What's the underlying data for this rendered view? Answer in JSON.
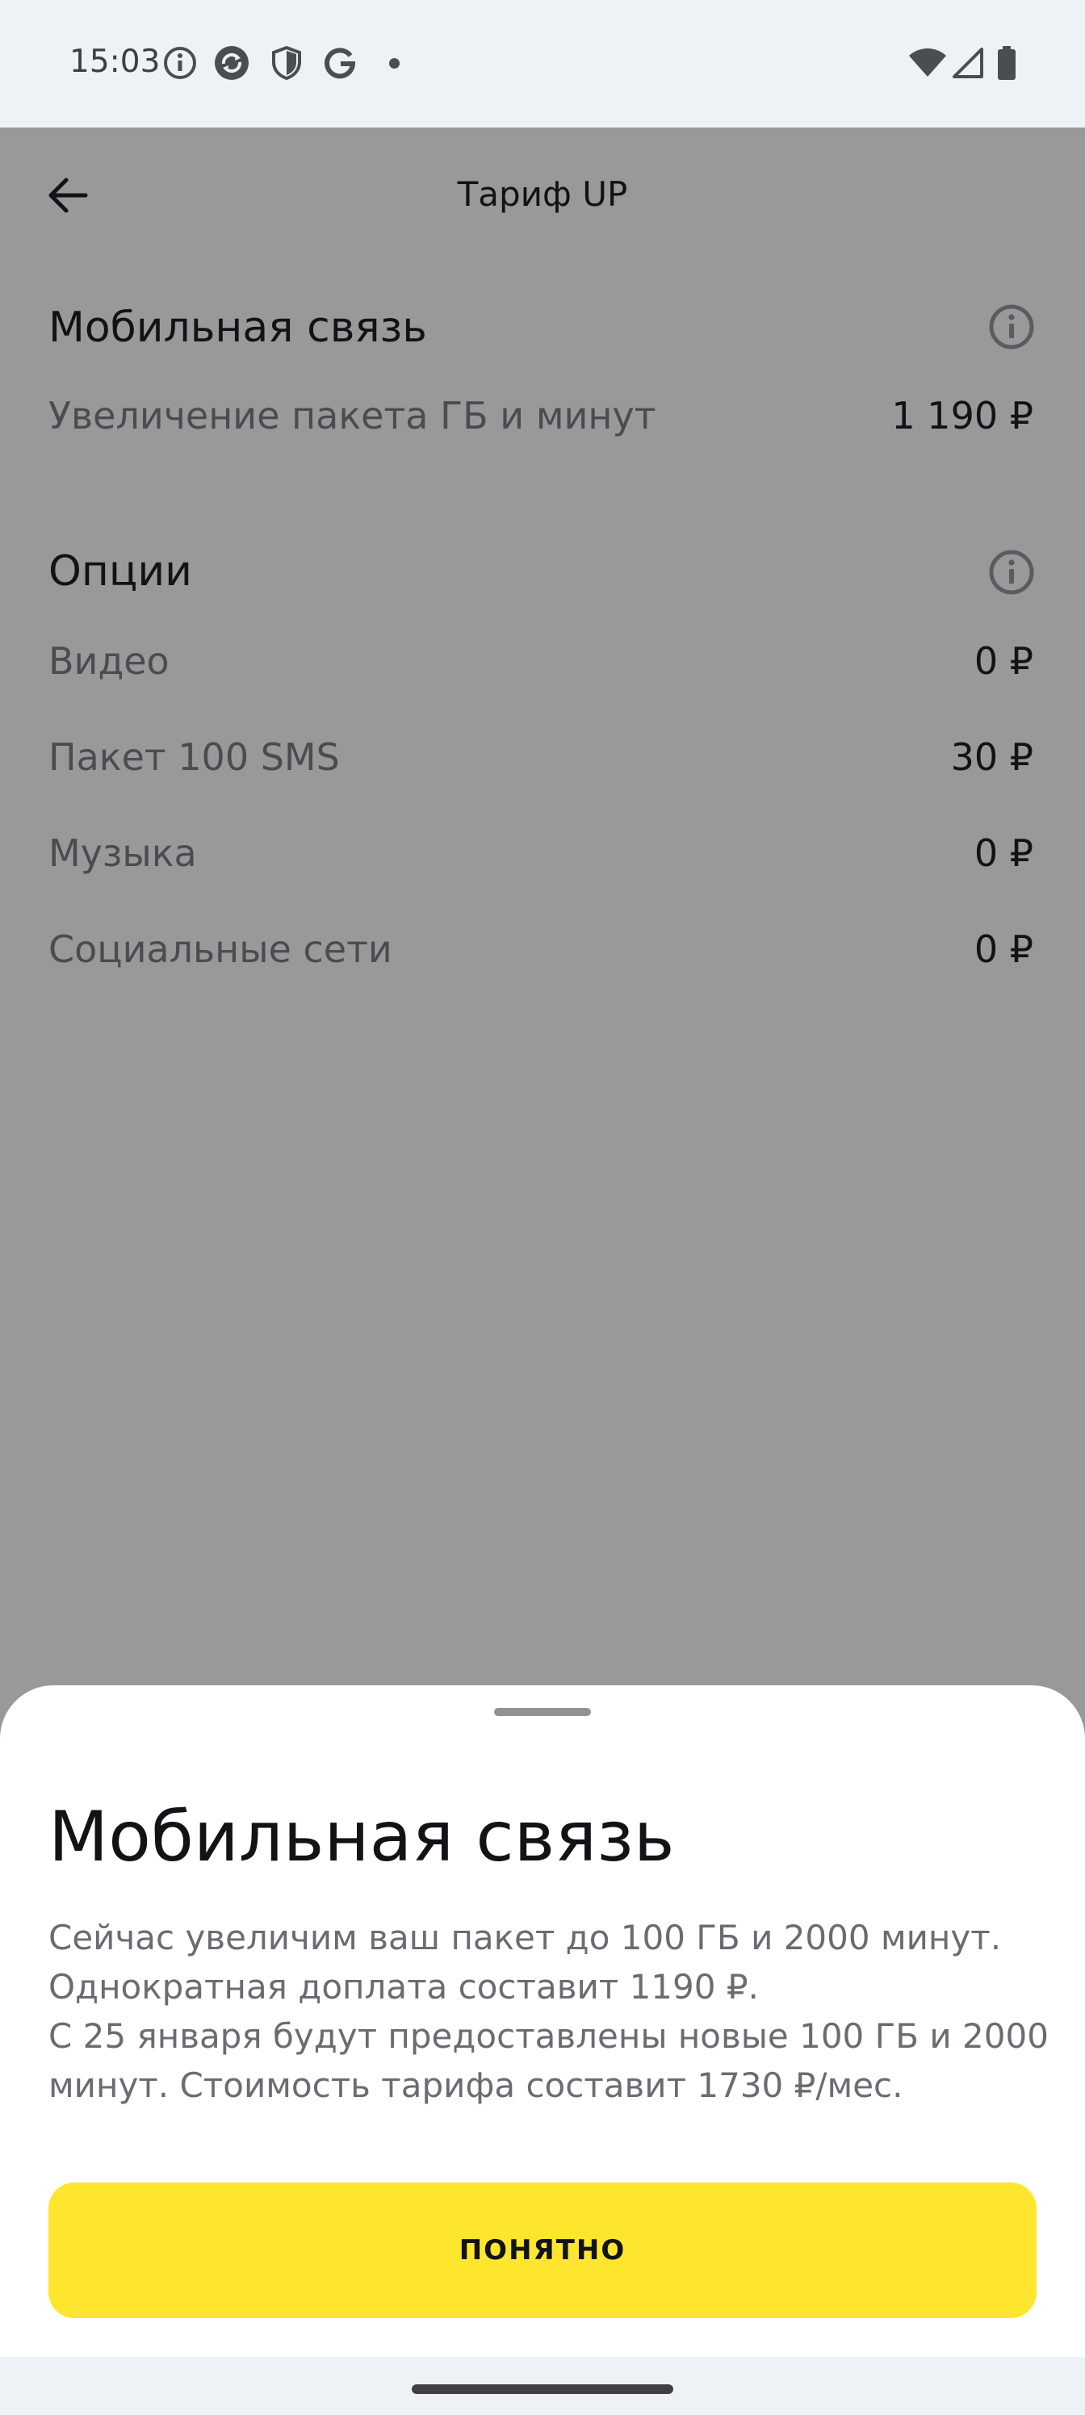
{
  "status_bar": {
    "time": "15:03",
    "icons": [
      "info-icon",
      "vpn-sync-icon",
      "shield-icon",
      "google-icon",
      "dot-icon",
      "wifi-icon",
      "signal-icon",
      "battery-icon"
    ]
  },
  "header": {
    "title": "Тариф UP",
    "back_icon": "arrow-left-icon"
  },
  "mobile": {
    "title": "Мобильная связь",
    "rows": [
      {
        "label": "Увеличение пакета ГБ и минут",
        "value": "1 190 ₽"
      }
    ]
  },
  "options": {
    "title": "Опции",
    "rows": [
      {
        "label": "Видео",
        "value": "0 ₽"
      },
      {
        "label": "Пакет 100 SMS",
        "value": "30 ₽"
      },
      {
        "label": "Музыка",
        "value": "0 ₽"
      },
      {
        "label": "Социальные сети",
        "value": "0 ₽"
      }
    ]
  },
  "sheet": {
    "title": "Мобильная связь",
    "lines": [
      "Сейчас увеличим ваш пакет до 100 ГБ и 2000 минут.",
      "Однократная доплата составит 1190 ₽.",
      "С 25 января будут предоставлены новые 100 ГБ и 2000",
      "минут. Стоимость тарифа составит 1730 ₽/мес."
    ],
    "button_label": "ПОНЯТНО"
  },
  "colors": {
    "accent": "#ffe62e",
    "scrim": "#999999",
    "text_primary": "#121316",
    "text_secondary": "#6a6c72"
  }
}
